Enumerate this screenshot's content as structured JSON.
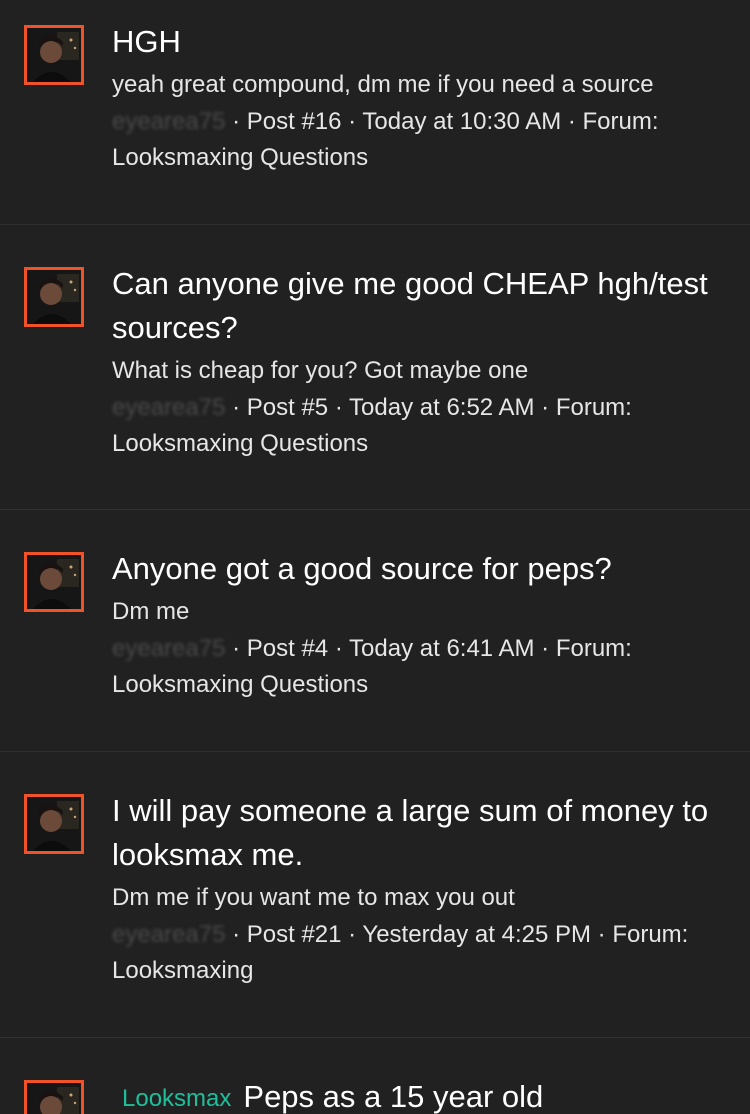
{
  "results": [
    {
      "title": "HGH",
      "snippet": "yeah great compound, dm me if you need a source",
      "user": "eyearea75",
      "meta_post": " · Post #16 · Today at 10:30 AM · Forum: ",
      "forum": "Looksmaxing Questions",
      "avatar_icon": "user-avatar-icon"
    },
    {
      "title": "Can anyone give me good CHEAP hgh/test sources?",
      "snippet": "What is cheap for you? Got maybe one",
      "user": "eyearea75",
      "meta_post": " · Post #5 · Today at 6:52 AM · Forum: ",
      "forum": "Looksmaxing Questions",
      "avatar_icon": "user-avatar-icon"
    },
    {
      "title": "Anyone got a good source for peps?",
      "snippet": "Dm me",
      "user": "eyearea75",
      "meta_post": " · Post #4 · Today at 6:41 AM · Forum: ",
      "forum": "Looksmaxing Questions",
      "avatar_icon": "user-avatar-icon"
    },
    {
      "title": "I will pay someone a large sum of money to looksmax me.",
      "snippet": "Dm me if you want me to max you out",
      "user": "eyearea75",
      "meta_post": " · Post #21 · Yesterday at 4:25 PM · ",
      "forum": "Forum: Looksmaxing",
      "avatar_icon": "user-avatar-icon"
    },
    {
      "prefix": "Looksmax",
      "title": "Peps as a 15 year old",
      "avatar_icon": "user-avatar-icon"
    }
  ],
  "colors": {
    "background": "#212121",
    "avatar_border": "#f0522a",
    "prefix": "#1fbf9b"
  }
}
